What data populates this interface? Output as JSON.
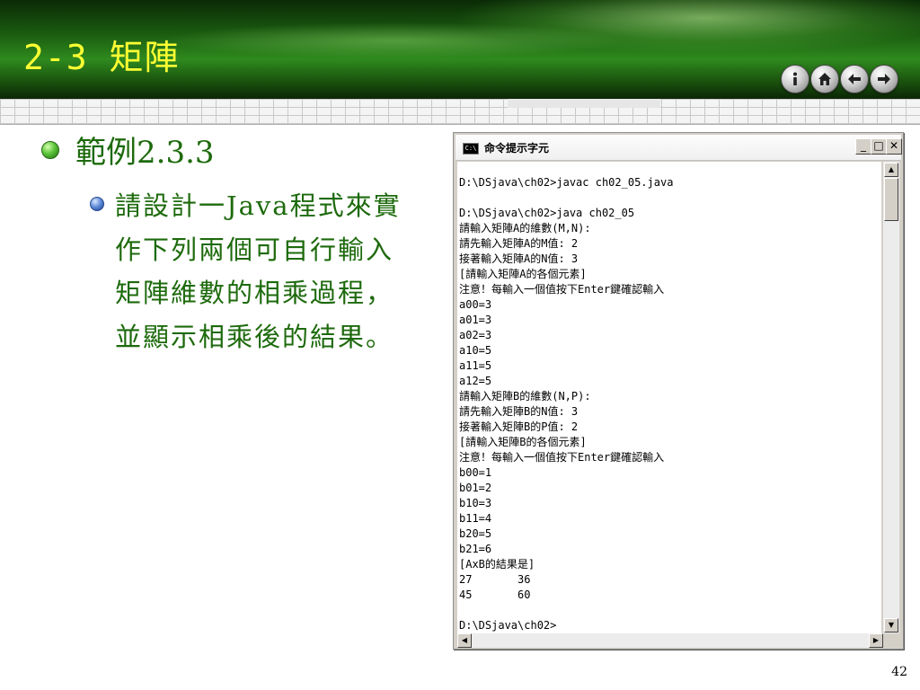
{
  "slide": {
    "title": "2-3 矩陣",
    "page_number": "42",
    "nav_buttons": [
      "info-icon",
      "home-icon",
      "back-arrow-icon",
      "forward-arrow-icon"
    ],
    "colors": {
      "title": "#ffff33",
      "body_text": "#1d6a0c",
      "header_green": "#1b5d10"
    }
  },
  "content": {
    "bullet_main": "範例2.3.3",
    "bullet_sub": "請設計一Java程式來實作下列兩個可自行輸入矩陣維數的相乘過程，並顯示相乘後的結果。"
  },
  "console": {
    "title": "命令提示字元",
    "icon_label": "C:\\",
    "lines": [
      "D:\\DSjava\\ch02>javac ch02_05.java",
      "",
      "D:\\DSjava\\ch02>java ch02_05",
      "請輸入矩陣A的維數(M,N):",
      "請先輸入矩陣A的M值: 2",
      "接著輸入矩陣A的N值: 3",
      "[請輸入矩陣A的各個元素]",
      "注意！每輸入一個值按下Enter鍵確認輸入",
      "a00=3",
      "a01=3",
      "a02=3",
      "a10=5",
      "a11=5",
      "a12=5",
      "請輸入矩陣B的維數(N,P):",
      "請先輸入矩陣B的N值: 3",
      "接著輸入矩陣B的P值: 2",
      "[請輸入矩陣B的各個元素]",
      "注意！每輸入一個值按下Enter鍵確認輸入",
      "b00=1",
      "b01=2",
      "b10=3",
      "b11=4",
      "b20=5",
      "b21=6",
      "[AxB的結果是]",
      "27       36",
      "45       60",
      "",
      "D:\\DSjava\\ch02>"
    ]
  }
}
